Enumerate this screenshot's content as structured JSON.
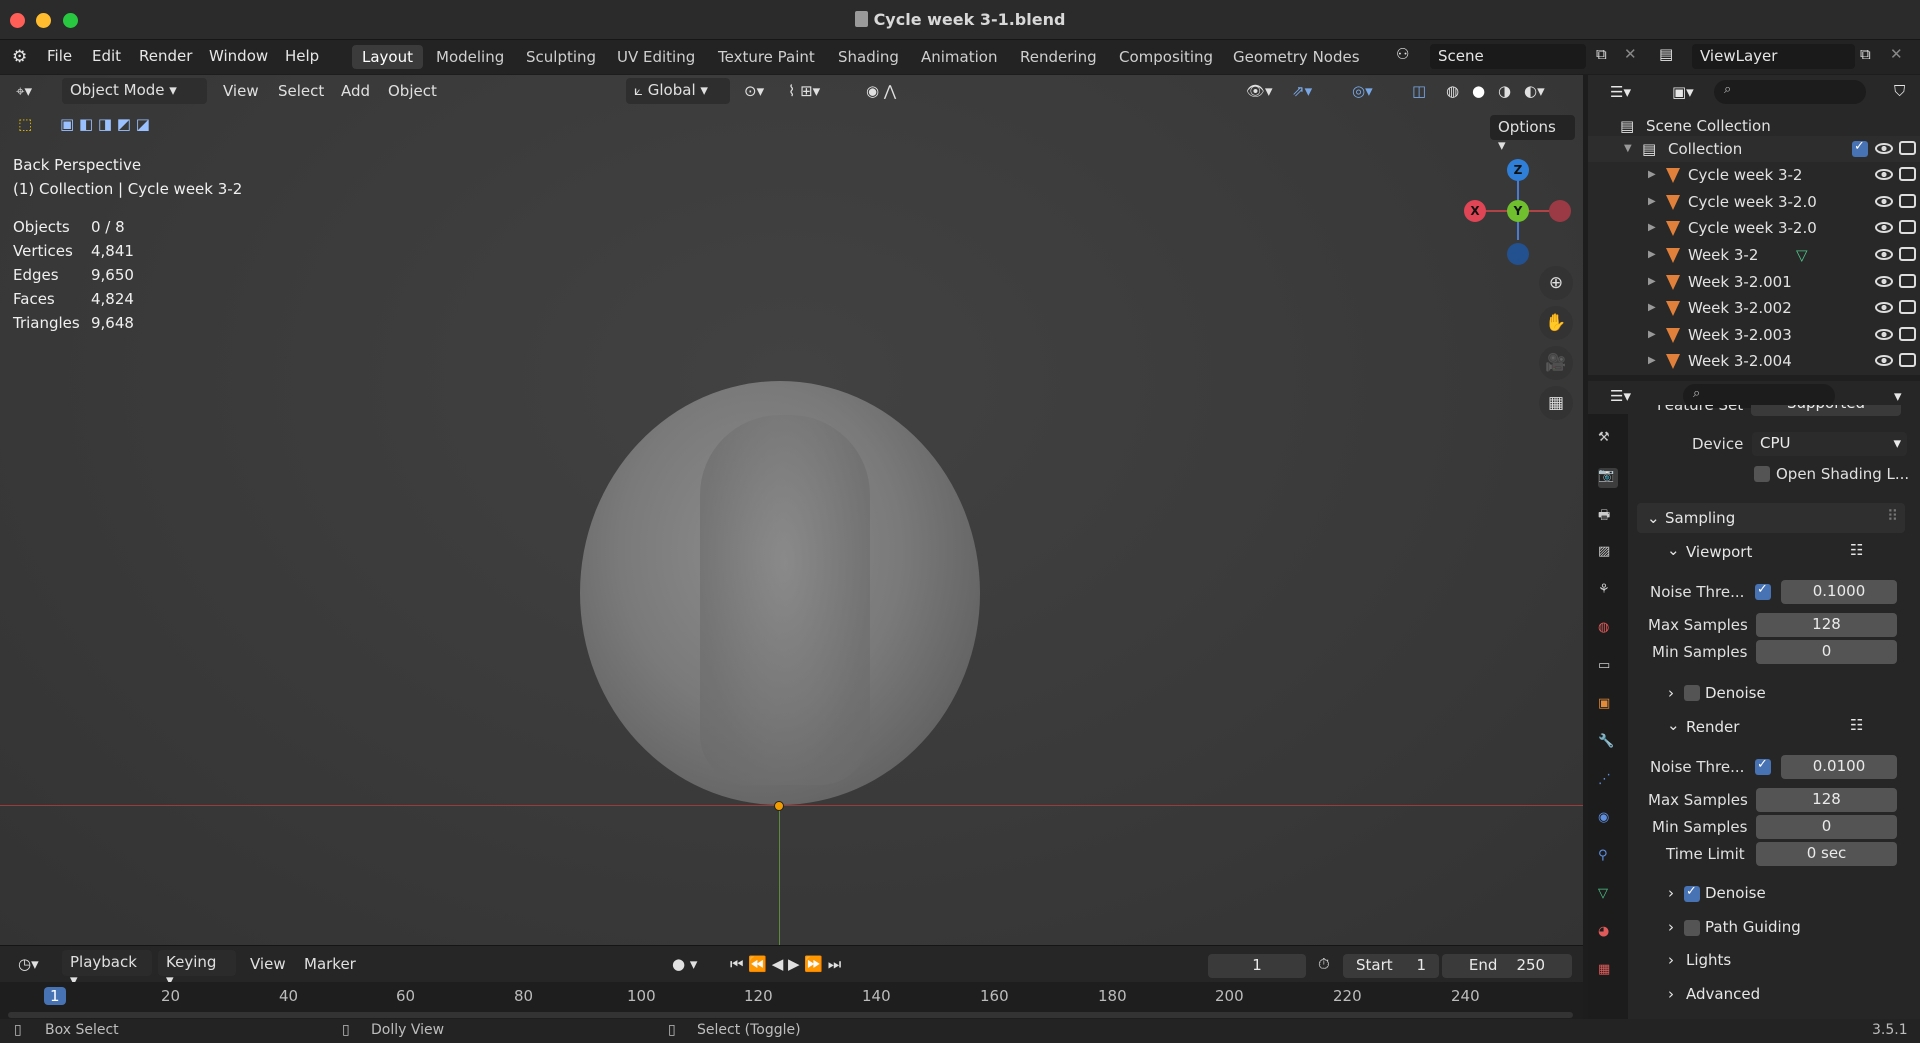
{
  "window": {
    "title": "Cycle week 3-1.blend"
  },
  "menu": {
    "items": [
      "File",
      "Edit",
      "Render",
      "Window",
      "Help"
    ]
  },
  "workspaces": [
    "Layout",
    "Modeling",
    "Sculpting",
    "UV Editing",
    "Texture Paint",
    "Shading",
    "Animation",
    "Rendering",
    "Compositing",
    "Geometry Nodes"
  ],
  "scene": "Scene",
  "viewlayer": "ViewLayer",
  "viewport_header": {
    "mode": "Object Mode",
    "menus": [
      "View",
      "Select",
      "Add",
      "Object"
    ],
    "transform": "Global",
    "options": "Options"
  },
  "overlay": {
    "view_name": "Back Perspective",
    "collection_line": "(1) Collection | Cycle week 3-2",
    "stats": [
      {
        "label": "Objects",
        "value": "0 / 8"
      },
      {
        "label": "Vertices",
        "value": "4,841"
      },
      {
        "label": "Edges",
        "value": "9,650"
      },
      {
        "label": "Faces",
        "value": "4,824"
      },
      {
        "label": "Triangles",
        "value": "9,648"
      }
    ]
  },
  "gizmo": {
    "x": "X",
    "y": "Y",
    "z": "Z"
  },
  "outliner": {
    "scene_collection": "Scene Collection",
    "collection": "Collection",
    "objects": [
      "Cycle week 3-2",
      "Cycle week 3-2.0",
      "Cycle week 3-2.0",
      "Week 3-2",
      "Week 3-2.001",
      "Week 3-2.002",
      "Week 3-2.003",
      "Week 3-2.004"
    ]
  },
  "properties": {
    "cut_off_label": "Feature Set",
    "cut_off_value": "Supported",
    "device_label": "Device",
    "device_value": "CPU",
    "open_shading": "Open Shading L...",
    "sampling": "Sampling",
    "viewport": "Viewport",
    "vp_noise_label": "Noise Thre...",
    "vp_noise": "0.1000",
    "vp_max_label": "Max Samples",
    "vp_max": "128",
    "vp_min_label": "Min Samples",
    "vp_min": "0",
    "vp_denoise": "Denoise",
    "render": "Render",
    "r_noise_label": "Noise Thre...",
    "r_noise": "0.0100",
    "r_max_label": "Max Samples",
    "r_max": "128",
    "r_min_label": "Min Samples",
    "r_min": "0",
    "r_time_label": "Time Limit",
    "r_time": "0 sec",
    "r_denoise": "Denoise",
    "path_guiding": "Path Guiding",
    "lights": "Lights",
    "advanced": "Advanced"
  },
  "timeline": {
    "playback": "Playback",
    "keying": "Keying",
    "view": "View",
    "marker": "Marker",
    "current_frame": "1",
    "start_label": "Start",
    "start": "1",
    "end_label": "End",
    "end": "250",
    "ruler": [
      "1",
      "20",
      "40",
      "60",
      "80",
      "100",
      "120",
      "140",
      "160",
      "180",
      "200",
      "220",
      "240"
    ]
  },
  "status": {
    "left": "Box Select",
    "mid": "Dolly View",
    "right": "Select (Toggle)",
    "version": "3.5.1"
  }
}
